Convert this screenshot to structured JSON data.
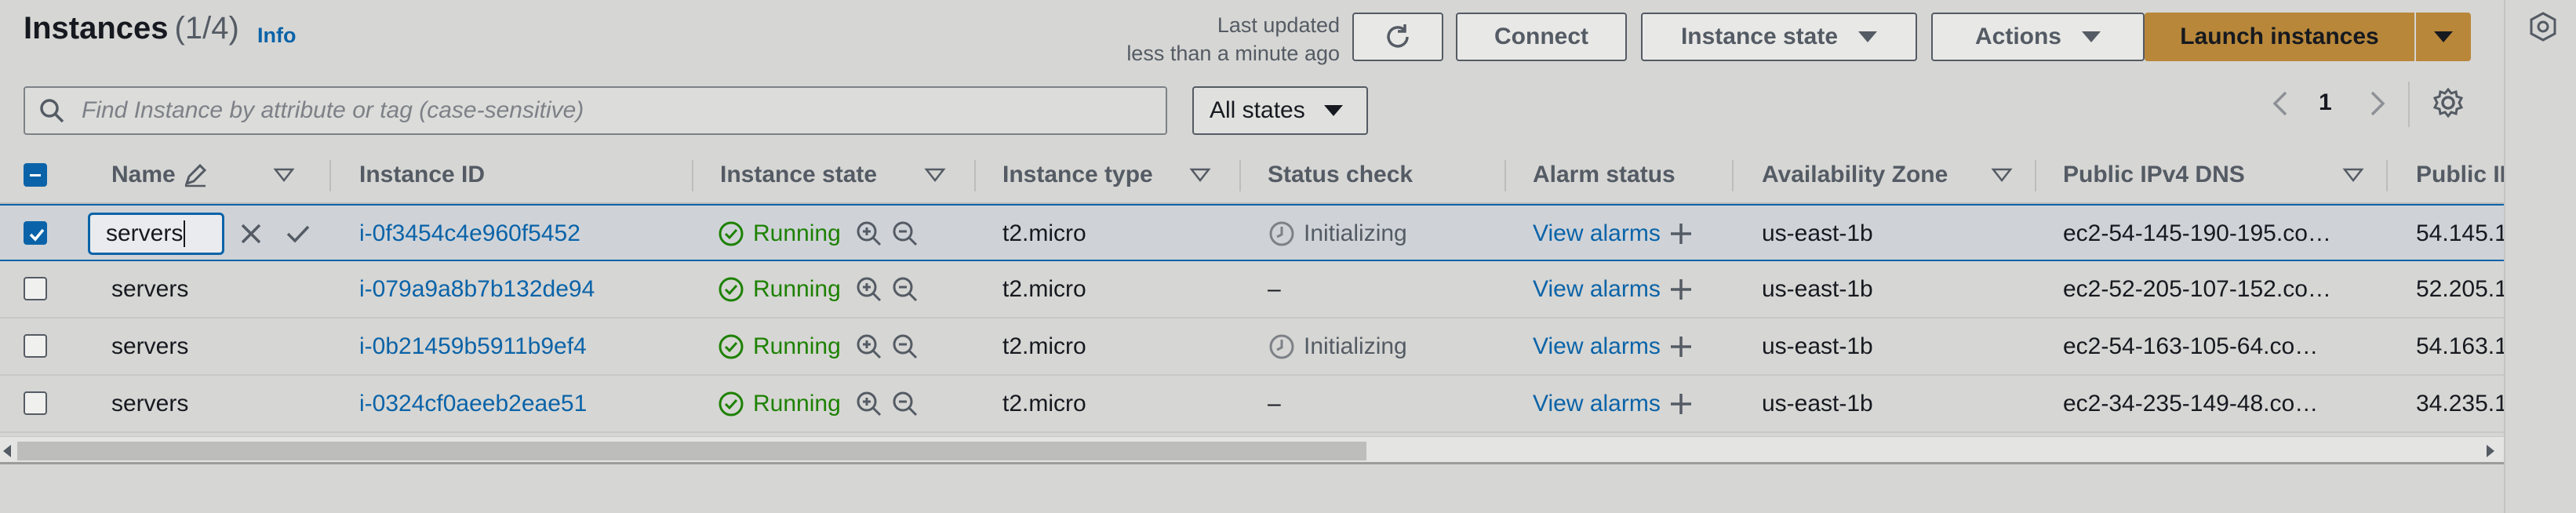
{
  "header": {
    "title": "Instances",
    "count": "(1/4)",
    "info": "Info",
    "last_updated_line1": "Last updated",
    "last_updated_line2": "less than a minute ago"
  },
  "toolbar": {
    "connect": "Connect",
    "instance_state": "Instance state",
    "actions": "Actions",
    "launch": "Launch instances"
  },
  "search": {
    "placeholder": "Find Instance by attribute or tag (case-sensitive)"
  },
  "filter": {
    "states": "All states"
  },
  "pagination": {
    "page": "1"
  },
  "columns": [
    "Name",
    "Instance ID",
    "Instance state",
    "Instance type",
    "Status check",
    "Alarm status",
    "Availability Zone",
    "Public IPv4 DNS",
    "Public IP"
  ],
  "rows": [
    {
      "name": "servers",
      "id": "i-0f3454c4e960f5452",
      "state": "Running",
      "type": "t2.micro",
      "status": "Initializing",
      "alarm": "View alarms",
      "az": "us-east-1b",
      "dns": "ec2-54-145-190-195.co…",
      "ip": "54.145.1",
      "selected": true
    },
    {
      "name": "servers",
      "id": "i-079a9a8b7b132de94",
      "state": "Running",
      "type": "t2.micro",
      "status": "–",
      "alarm": "View alarms",
      "az": "us-east-1b",
      "dns": "ec2-52-205-107-152.co…",
      "ip": "52.205.1",
      "selected": false
    },
    {
      "name": "servers",
      "id": "i-0b21459b5911b9ef4",
      "state": "Running",
      "type": "t2.micro",
      "status": "Initializing",
      "alarm": "View alarms",
      "az": "us-east-1b",
      "dns": "ec2-54-163-105-64.co…",
      "ip": "54.163.1",
      "selected": false
    },
    {
      "name": "servers",
      "id": "i-0324cf0aeeb2eae51",
      "state": "Running",
      "type": "t2.micro",
      "status": "–",
      "alarm": "View alarms",
      "az": "us-east-1b",
      "dns": "ec2-34-235-149-48.co…",
      "ip": "34.235.1",
      "selected": false
    }
  ],
  "colors": {
    "accent": "#0a63a8",
    "running": "#1d8102",
    "launch": "#b8873a"
  }
}
